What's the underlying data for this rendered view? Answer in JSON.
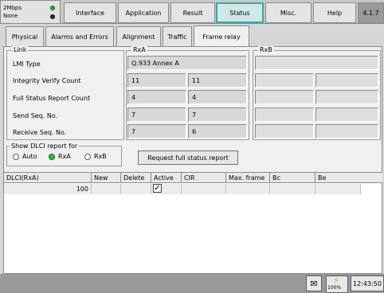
{
  "status": {
    "line1": "2Mbps",
    "line2": "None",
    "led1_color": "#30b030",
    "led2_color": "#303030"
  },
  "main_tabs": [
    {
      "label": "Interface",
      "active": false
    },
    {
      "label": "Application",
      "active": false
    },
    {
      "label": "Result",
      "active": false
    },
    {
      "label": "Status",
      "active": true
    },
    {
      "label": "Misc.",
      "active": false
    },
    {
      "label": "Help",
      "active": false
    }
  ],
  "version": "4.1.7",
  "sub_tabs": [
    {
      "label": "Physical",
      "active": false
    },
    {
      "label": "Alarms and Errors",
      "active": false
    },
    {
      "label": "Alignment",
      "active": false
    },
    {
      "label": "Traffic",
      "active": false
    },
    {
      "label": "Frame relay",
      "active": true
    }
  ],
  "link": {
    "group_label": "Link",
    "rxa_label": "RxA",
    "rxb_label": "RxB",
    "rows": [
      {
        "label": "LMI Type",
        "rxa": "Q.933 Annex A"
      },
      {
        "label": "Integrity Verify Count",
        "rxa_1": "11",
        "rxa_2": "11"
      },
      {
        "label": "Full Status Report Count",
        "rxa_1": "4",
        "rxa_2": "4"
      },
      {
        "label": "Send Seq. No.",
        "rxa_1": "7",
        "rxa_2": "7"
      },
      {
        "label": "Receive Seq. No.",
        "rxa_1": "7",
        "rxa_2": "6"
      }
    ]
  },
  "dlci_report": {
    "label": "Show DLCI report for",
    "options": [
      {
        "label": "Auto",
        "selected": false
      },
      {
        "label": "RxA",
        "selected": true
      },
      {
        "label": "RxB",
        "selected": false
      }
    ],
    "request_button": "Request full status report"
  },
  "table": {
    "headers": [
      "DLCI(RxA)",
      "New",
      "Delete",
      "Active",
      "CIR",
      "Max. frame",
      "Bc",
      "Be"
    ],
    "rows": [
      {
        "dlci": "100",
        "new": "",
        "delete": "",
        "active": true,
        "cir": "",
        "max_frame": "",
        "bc": "",
        "be": ""
      }
    ]
  },
  "bottom": {
    "battery_percent": "100%",
    "clock": "12:43:50",
    "bluetooth_icon": "bluetooth-icon",
    "battery_icon": "battery-bolt-icon"
  }
}
